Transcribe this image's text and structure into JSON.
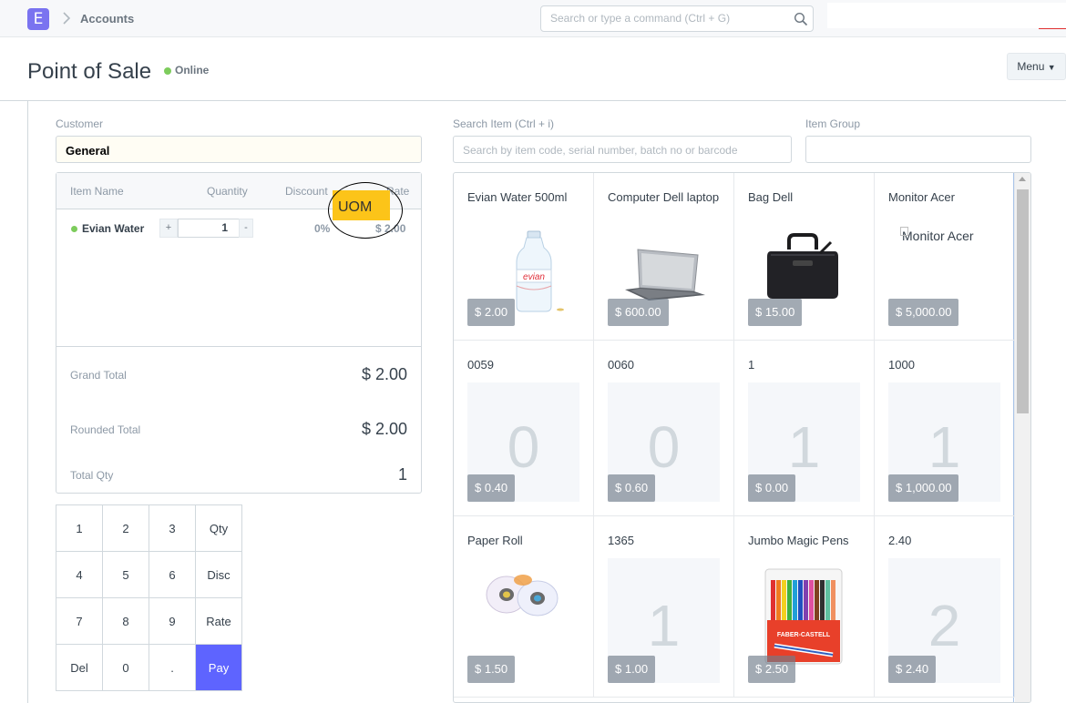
{
  "navbar": {
    "logo_letter": "E",
    "breadcrumb": "Accounts",
    "search_placeholder": "Search or type a command (Ctrl + G)"
  },
  "page": {
    "title": "Point of Sale",
    "status": "Online",
    "menu_label": "Menu"
  },
  "customer": {
    "label": "Customer",
    "value": "General"
  },
  "search_item": {
    "label": "Search Item (Ctrl + i)",
    "placeholder": "Search by item code, serial number, batch no or barcode"
  },
  "item_group": {
    "label": "Item Group",
    "value": ""
  },
  "cart": {
    "columns": [
      "Item Name",
      "Quantity",
      "Discount",
      "Rate"
    ],
    "items": [
      {
        "name": "Evian Water",
        "qty": "1",
        "discount": "0%",
        "rate": "$ 2.00",
        "plus": "+",
        "minus": "-"
      }
    ],
    "uom_tooltip": "UOM",
    "grand_total_label": "Grand Total",
    "grand_total": "$ 2.00",
    "rounded_total_label": "Rounded Total",
    "rounded_total": "$ 2.00",
    "total_qty_label": "Total Qty",
    "total_qty": "1"
  },
  "keypad": {
    "keys": [
      "1",
      "2",
      "3",
      "Qty",
      "4",
      "5",
      "6",
      "Disc",
      "7",
      "8",
      "9",
      "Rate",
      "Del",
      "0",
      ".",
      "Pay"
    ]
  },
  "items": [
    {
      "name": "Evian Water 500ml",
      "price": "$ 2.00",
      "image": "water-bottle"
    },
    {
      "name": "Computer Dell laptop",
      "price": "$ 600.00",
      "image": "laptop"
    },
    {
      "name": "Bag Dell",
      "price": "$ 15.00",
      "image": "bag"
    },
    {
      "name": "Monitor Acer",
      "price": "$ 5,000.00",
      "image": "broken",
      "alt": "Monitor Acer"
    },
    {
      "name": "0059",
      "price": "$ 0.40",
      "abbr": "0"
    },
    {
      "name": "0060",
      "price": "$ 0.60",
      "abbr": "0"
    },
    {
      "name": "1",
      "price": "$ 0.00",
      "abbr": "1"
    },
    {
      "name": "1000",
      "price": "$ 1,000.00",
      "abbr": "1"
    },
    {
      "name": "Paper Roll",
      "price": "$ 1.50",
      "image": "paper-roll"
    },
    {
      "name": "1365",
      "price": "$ 1.00",
      "abbr": "1"
    },
    {
      "name": "Jumbo Magic Pens",
      "price": "$ 2.50",
      "image": "pens"
    },
    {
      "name": "2.40",
      "price": "$ 2.40",
      "abbr": "2"
    }
  ],
  "pens_brand": "FABER-CASTELL",
  "bottle_brand": "evian",
  "colors": {
    "accent": "#5e64ff",
    "online": "#7dcc5c",
    "tooltip": "#fcc419"
  }
}
